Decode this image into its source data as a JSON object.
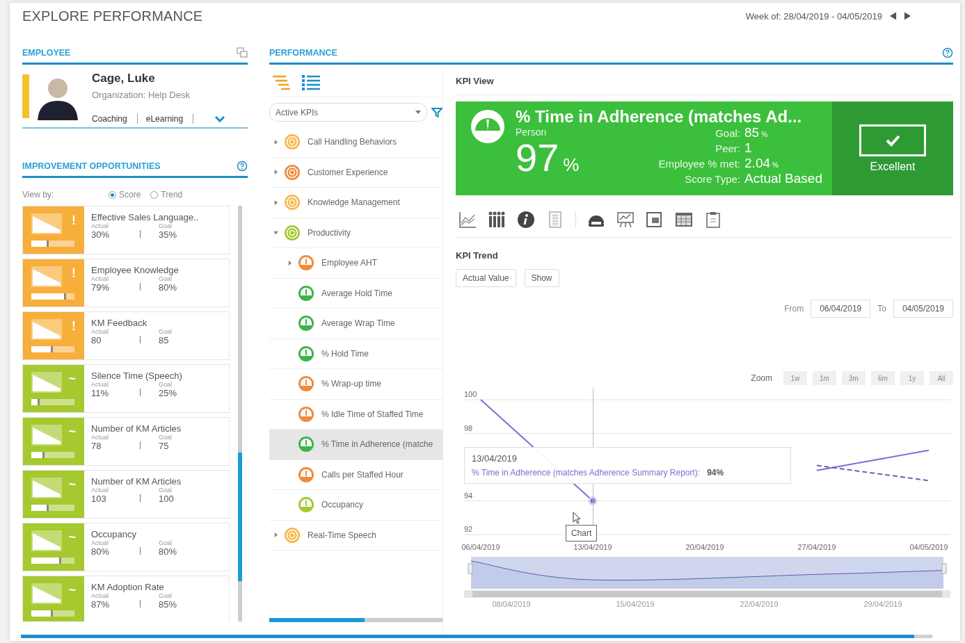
{
  "title": "EXPLORE PERFORMANCE",
  "week": "Week of: 28/04/2019 - 04/05/2019",
  "employee": {
    "heading": "EMPLOYEE",
    "name": "Cage, Luke",
    "organization": "Organization: Help Desk",
    "links": [
      "Coaching",
      "eLearning"
    ]
  },
  "improvement": {
    "heading": "IMPROVEMENT OPPORTUNITIES",
    "view_by": "View by:",
    "options": [
      {
        "label": "Score",
        "selected": true
      },
      {
        "label": "Trend",
        "selected": false
      }
    ],
    "cards": [
      {
        "name": "Effective Sales Language..",
        "actual_label": "Actual",
        "actual": "30%",
        "goal_label": "Goal",
        "goal": "35%",
        "symbol": "!",
        "color": "#f7ae3a",
        "level": 0.4
      },
      {
        "name": "Employee Knowledge",
        "actual_label": "Actual",
        "actual": "79%",
        "goal_label": "Goal",
        "goal": "80%",
        "symbol": "!",
        "color": "#f7ae3a",
        "level": 0.8
      },
      {
        "name": "KM Feedback",
        "actual_label": "Actual",
        "actual": "80",
        "goal_label": "Goal",
        "goal": "85",
        "symbol": "!",
        "color": "#f7ae3a",
        "level": 0.5
      },
      {
        "name": "Silence Time (Speech)",
        "actual_label": "Actual",
        "actual": "11%",
        "goal_label": "Goal",
        "goal": "25%",
        "symbol": "~",
        "color": "#a5c92f",
        "level": 0.2
      },
      {
        "name": "Number of KM Articles",
        "actual_label": "Actual",
        "actual": "78",
        "goal_label": "Goal",
        "goal": "75",
        "symbol": "~",
        "color": "#a5c92f",
        "level": 0.3
      },
      {
        "name": "Number of KM Articles",
        "actual_label": "Actual",
        "actual": "103",
        "goal_label": "Goal",
        "goal": "100",
        "symbol": "~",
        "color": "#a5c92f",
        "level": 0.4
      },
      {
        "name": "Occupancy",
        "actual_label": "Actual",
        "actual": "80%",
        "goal_label": "Goal",
        "goal": "80%",
        "symbol": "~",
        "color": "#a5c92f",
        "level": 0.7
      },
      {
        "name": "KM Adoption Rate",
        "actual_label": "Actual",
        "actual": "87%",
        "goal_label": "Goal",
        "goal": "85%",
        "symbol": "~",
        "color": "#a5c92f",
        "level": 0.5
      }
    ]
  },
  "performance": {
    "heading": "PERFORMANCE",
    "filter": "Active KPIs",
    "tree": [
      {
        "label": "Call Handling Behaviors",
        "kind": "group",
        "expanded": false,
        "color": "#f7b84a",
        "selected": false
      },
      {
        "label": "Customer Experience",
        "kind": "group",
        "expanded": false,
        "color": "#f08a3c",
        "selected": false
      },
      {
        "label": "Knowledge Management",
        "kind": "group",
        "expanded": false,
        "color": "#f7b84a",
        "selected": false
      },
      {
        "label": "Productivity",
        "kind": "group",
        "expanded": true,
        "color": "#a5c92f",
        "selected": false,
        "children": [
          {
            "label": "Employee AHT",
            "kind": "kpi",
            "expanded": false,
            "color": "#f08a3c",
            "selected": false
          },
          {
            "label": "Average Hold Time",
            "kind": "kpi",
            "color": "#3cb44a",
            "selected": false
          },
          {
            "label": "Average Wrap Time",
            "kind": "kpi",
            "color": "#3cb44a",
            "selected": false
          },
          {
            "label": "% Hold Time",
            "kind": "kpi",
            "color": "#3cb44a",
            "selected": false
          },
          {
            "label": "% Wrap-up time",
            "kind": "kpi",
            "color": "#f08a3c",
            "selected": false
          },
          {
            "label": "% Idle Time of Staffed Time",
            "kind": "kpi",
            "color": "#f08a3c",
            "selected": false
          },
          {
            "label": "% Time in Adherence (matche",
            "kind": "kpi",
            "color": "#3cb44a",
            "selected": true
          },
          {
            "label": "Calls per Staffed Hour",
            "kind": "kpi",
            "color": "#f08a3c",
            "selected": false
          },
          {
            "label": "Occupancy",
            "kind": "kpi",
            "color": "#a5c92f",
            "selected": false
          }
        ]
      },
      {
        "label": "Real-Time Speech",
        "kind": "group",
        "expanded": false,
        "color": "#f7b84a",
        "selected": false
      }
    ]
  },
  "kpi_view": {
    "heading": "KPI View",
    "title": "% Time in Adherence (matches Ad...",
    "subtitle": "Person",
    "value": "97",
    "unit": "%",
    "stats": [
      {
        "label": "Goal:",
        "value": "85",
        "unit": "%"
      },
      {
        "label": "Peer:",
        "value": "1"
      },
      {
        "label": "Employee % met:",
        "value": "2.04",
        "unit": "%"
      },
      {
        "label": "Score Type:",
        "value": "Actual Based"
      }
    ],
    "rating": "Excellent"
  },
  "kpi_trend": {
    "heading": "KPI Trend",
    "buttons": [
      "Actual Value",
      "Show"
    ],
    "from_label": "From",
    "from": "06/04/2019",
    "to_label": "To",
    "to": "04/05/2019",
    "zoom_label": "Zoom",
    "zoom_buttons": [
      "1w",
      "1m",
      "3m",
      "6m",
      "1y",
      "All"
    ],
    "tooltip": {
      "date": "13/04/2019",
      "separator": ":",
      "value": "94%"
    },
    "cursor_tip": "Chart",
    "navigator_labels": [
      "08/04/2019",
      "15/04/2019",
      "22/04/2019",
      "29/04/2019"
    ],
    "chart_data": {
      "type": "line",
      "categories": [
        "06/04/2019",
        "13/04/2019",
        "20/04/2019",
        "27/04/2019",
        "04/05/2019"
      ],
      "ylim": [
        92,
        100
      ],
      "yticks": [
        92,
        94,
        98,
        100
      ],
      "series": [
        {
          "name": "% Time in Adherence (matches Adherence Summary Report)",
          "color": "#7b6fd0",
          "line_style": "solid",
          "values": [
            100,
            94,
            null,
            95.8,
            97
          ]
        },
        {
          "color": "#6a60b8",
          "line_style": "dashed",
          "values": [
            null,
            null,
            null,
            96.1,
            95.2
          ]
        }
      ]
    }
  }
}
